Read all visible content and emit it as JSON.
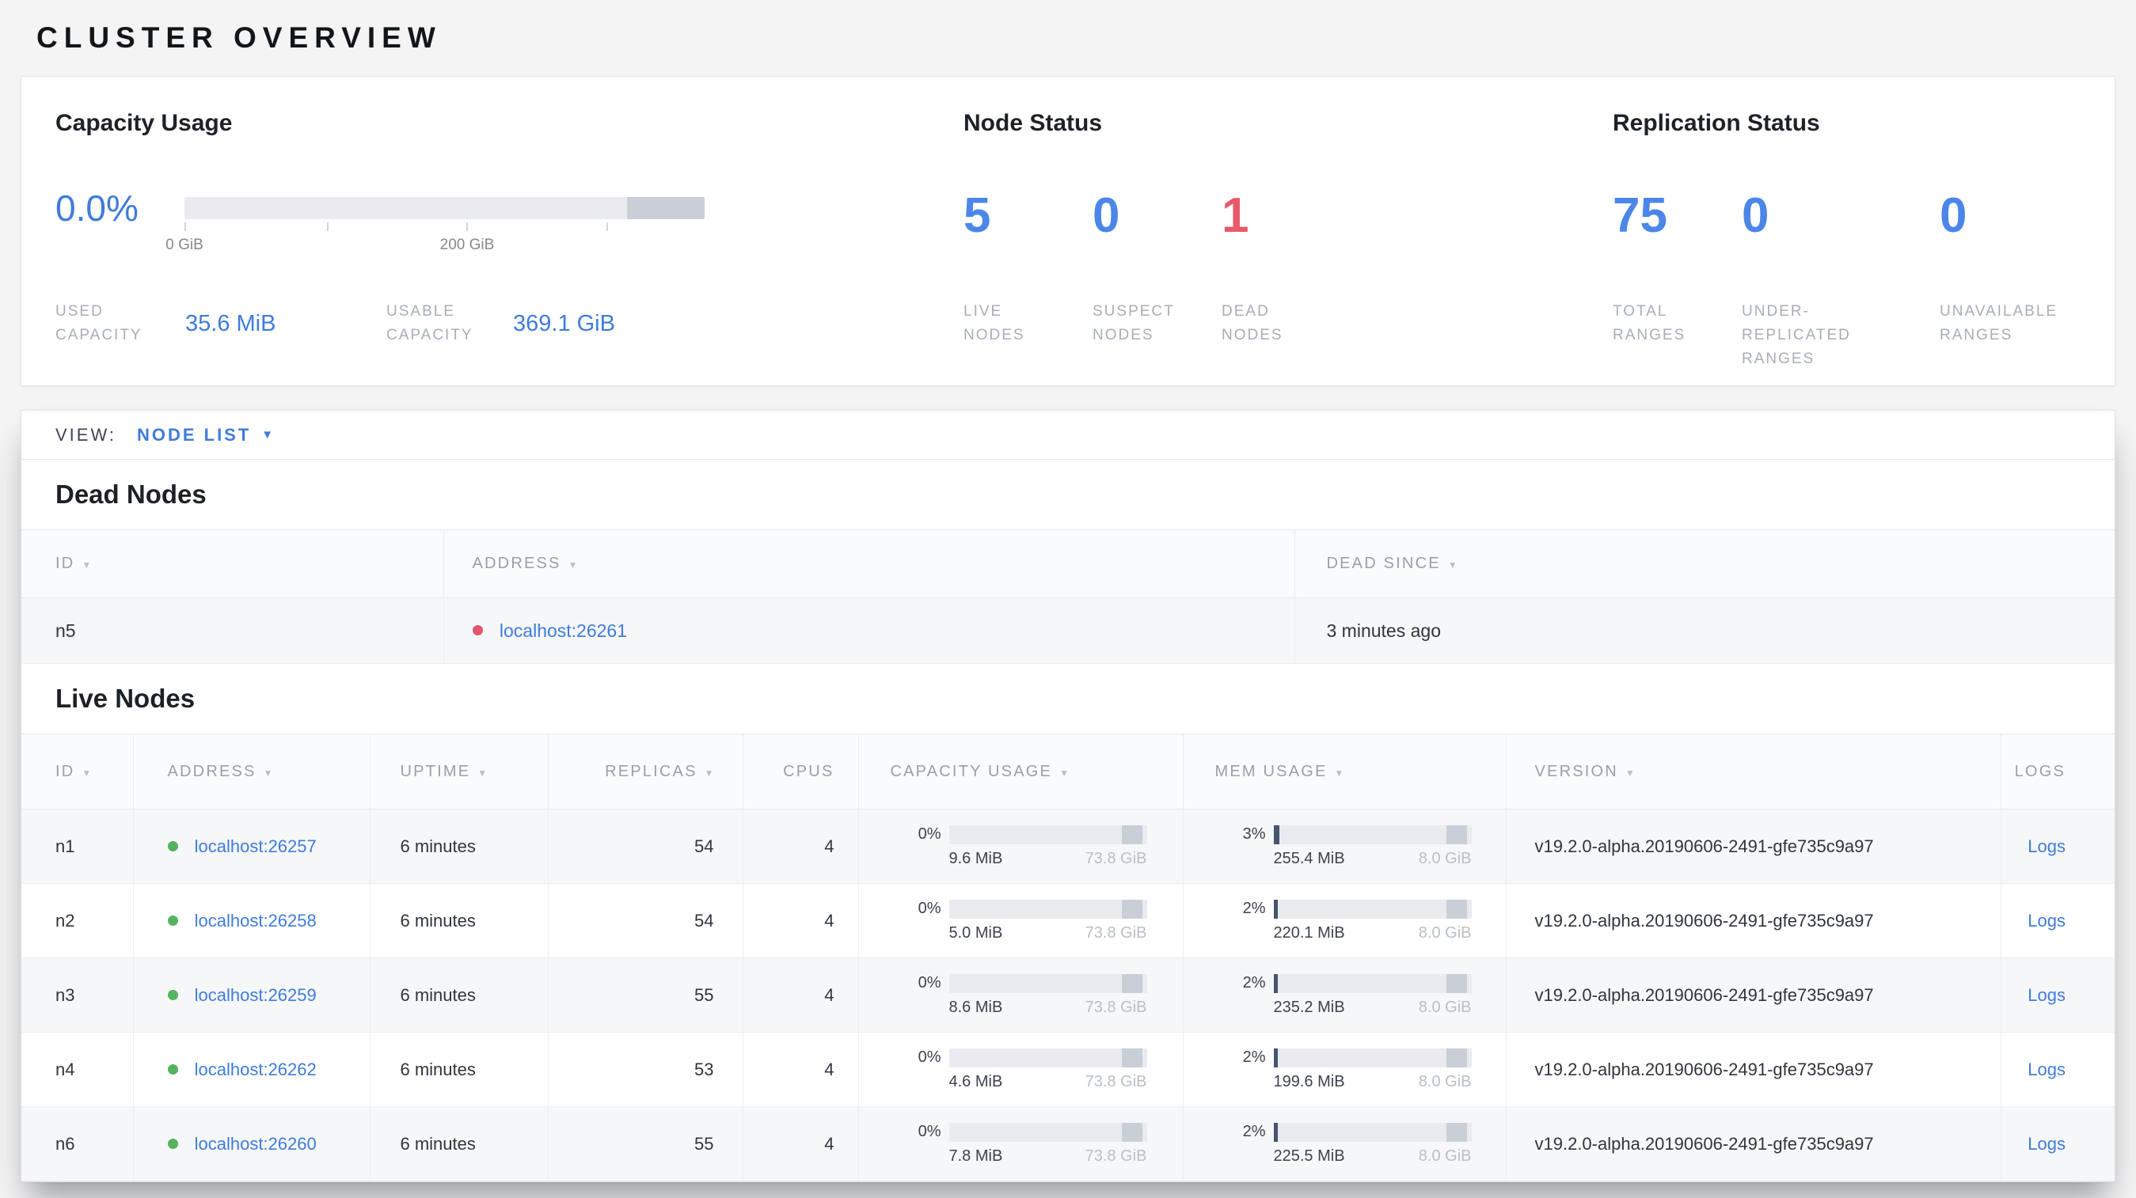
{
  "colors": {
    "accent_blue": "#3f7cdb",
    "danger_red": "#e8596a",
    "live_green": "#55b35f",
    "bar_fill": "#46546d"
  },
  "page": {
    "title": "CLUSTER OVERVIEW"
  },
  "summary": {
    "capacity": {
      "title": "Capacity Usage",
      "percent": "0.0%",
      "axis_ticks": [
        "0 GiB",
        "200 GiB"
      ],
      "used_label": "USED CAPACITY",
      "used_value": "35.6 MiB",
      "usable_label": "USABLE CAPACITY",
      "usable_value": "369.1 GiB"
    },
    "node_status": {
      "title": "Node Status",
      "stats": [
        {
          "value": "5",
          "label": "LIVE NODES",
          "color": "#4c86e8"
        },
        {
          "value": "0",
          "label": "SUSPECT NODES",
          "color": "#4c86e8"
        },
        {
          "value": "1",
          "label": "DEAD NODES",
          "color": "#e8596a"
        }
      ]
    },
    "replication": {
      "title": "Replication Status",
      "stats": [
        {
          "value": "75",
          "label": "TOTAL RANGES",
          "color": "#4c86e8"
        },
        {
          "value": "0",
          "label": "UNDER-REPLICATED RANGES",
          "color": "#4c86e8"
        },
        {
          "value": "0",
          "label": "UNAVAILABLE RANGES",
          "color": "#4c86e8"
        }
      ]
    }
  },
  "view_bar": {
    "label": "VIEW:",
    "selected": "NODE LIST"
  },
  "dead_nodes": {
    "title": "Dead Nodes",
    "columns": [
      "ID",
      "ADDRESS",
      "DEAD SINCE"
    ],
    "rows": [
      {
        "id": "n5",
        "address": "localhost:26261",
        "dead_since": "3 minutes ago"
      }
    ]
  },
  "live_nodes": {
    "title": "Live Nodes",
    "columns": [
      "ID",
      "ADDRESS",
      "UPTIME",
      "REPLICAS",
      "CPUS",
      "CAPACITY USAGE",
      "MEM USAGE",
      "VERSION",
      "LOGS"
    ],
    "rows": [
      {
        "id": "n1",
        "address": "localhost:26257",
        "uptime": "6 minutes",
        "replicas": "54",
        "cpus": "4",
        "capacity_pct": "0%",
        "capacity_used": "9.6 MiB",
        "capacity_total": "73.8 GiB",
        "mem_pct": "3%",
        "mem_used": "255.4 MiB",
        "mem_total": "8.0 GiB",
        "version": "v19.2.0-alpha.20190606-2491-gfe735c9a97",
        "logs": "Logs"
      },
      {
        "id": "n2",
        "address": "localhost:26258",
        "uptime": "6 minutes",
        "replicas": "54",
        "cpus": "4",
        "capacity_pct": "0%",
        "capacity_used": "5.0 MiB",
        "capacity_total": "73.8 GiB",
        "mem_pct": "2%",
        "mem_used": "220.1 MiB",
        "mem_total": "8.0 GiB",
        "version": "v19.2.0-alpha.20190606-2491-gfe735c9a97",
        "logs": "Logs"
      },
      {
        "id": "n3",
        "address": "localhost:26259",
        "uptime": "6 minutes",
        "replicas": "55",
        "cpus": "4",
        "capacity_pct": "0%",
        "capacity_used": "8.6 MiB",
        "capacity_total": "73.8 GiB",
        "mem_pct": "2%",
        "mem_used": "235.2 MiB",
        "mem_total": "8.0 GiB",
        "version": "v19.2.0-alpha.20190606-2491-gfe735c9a97",
        "logs": "Logs"
      },
      {
        "id": "n4",
        "address": "localhost:26262",
        "uptime": "6 minutes",
        "replicas": "53",
        "cpus": "4",
        "capacity_pct": "0%",
        "capacity_used": "4.6 MiB",
        "capacity_total": "73.8 GiB",
        "mem_pct": "2%",
        "mem_used": "199.6 MiB",
        "mem_total": "8.0 GiB",
        "version": "v19.2.0-alpha.20190606-2491-gfe735c9a97",
        "logs": "Logs"
      },
      {
        "id": "n6",
        "address": "localhost:26260",
        "uptime": "6 minutes",
        "replicas": "55",
        "cpus": "4",
        "capacity_pct": "0%",
        "capacity_used": "7.8 MiB",
        "capacity_total": "73.8 GiB",
        "mem_pct": "2%",
        "mem_used": "225.5 MiB",
        "mem_total": "8.0 GiB",
        "version": "v19.2.0-alpha.20190606-2491-gfe735c9a97",
        "logs": "Logs"
      }
    ]
  }
}
